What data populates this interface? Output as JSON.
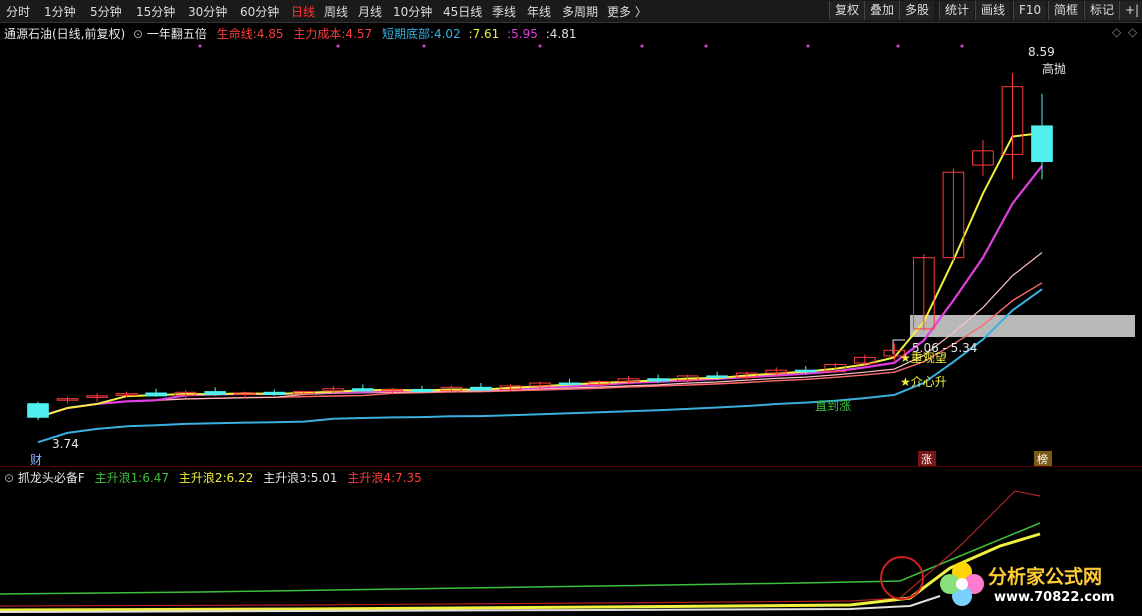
{
  "toolbar": {
    "periods": [
      "分时",
      "1分钟",
      "5分钟",
      "15分钟",
      "30分钟",
      "60分钟",
      "日线",
      "周线",
      "月线",
      "10分钟",
      "45日线",
      "季线",
      "年线",
      "多周期",
      "更多 〉"
    ],
    "active": "日线",
    "right": [
      "复权",
      "叠加",
      "多股",
      "统计",
      "画线",
      "F10",
      "简框",
      "标记",
      "+|"
    ]
  },
  "main_info": {
    "stock": "通源石油(日线,前复权)",
    "indicator": "一年翻五倍",
    "items": [
      {
        "label": "生命线:",
        "value": "4.85",
        "color": "#ff3b3b"
      },
      {
        "label": "主力成本:",
        "value": "4.57",
        "color": "#ff3b3b"
      },
      {
        "label": "短期底部:",
        "value": "4.02",
        "color": "#3ab0e0"
      },
      {
        "label": ":",
        "value": "7.61",
        "color": "#f0f040"
      },
      {
        "label": ":",
        "value": "5.95",
        "color": "#e040e0"
      },
      {
        "label": ":",
        "value": "4.81",
        "color": "#e0e0e0"
      }
    ]
  },
  "sub_info": {
    "indicator": "抓龙头必备F",
    "items": [
      {
        "label": "主升浪1:",
        "value": "6.47",
        "color": "#3cc03c"
      },
      {
        "label": "主升浪2:",
        "value": "6.22",
        "color": "#f0f040"
      },
      {
        "label": "主升浪3:",
        "value": "5.01",
        "color": "#e0e0e0"
      },
      {
        "label": "主升浪4:",
        "value": "7.35",
        "color": "#ff3b3b"
      }
    ]
  },
  "annotations": {
    "high": "8.59",
    "high_tag": "高抛",
    "low": "3.74",
    "zone": "5.06 - 5.34",
    "star1": "★重观望",
    "star2": "★介心升",
    "mid_text": "直到涨",
    "cai": "财",
    "zhang": "涨",
    "bang": "榜"
  },
  "watermark": {
    "text": "分析家公式网",
    "url": "www.70822.com"
  },
  "colors": {
    "up": "#ff3b3b",
    "down": "#50f0f0",
    "bg": "#000000"
  },
  "chart_data": {
    "type": "candlestick",
    "ylim": [
      3.3,
      9.0
    ],
    "note_levels": {
      "high": 8.59,
      "low": 3.74
    },
    "candles": [
      {
        "o": 3.95,
        "h": 3.98,
        "l": 3.72,
        "c": 3.76
      },
      {
        "o": 4.0,
        "h": 4.05,
        "l": 3.95,
        "c": 4.02
      },
      {
        "o": 4.04,
        "h": 4.1,
        "l": 3.98,
        "c": 4.06
      },
      {
        "o": 4.08,
        "h": 4.12,
        "l": 4.04,
        "c": 4.09
      },
      {
        "o": 4.1,
        "h": 4.16,
        "l": 4.05,
        "c": 4.06
      },
      {
        "o": 4.07,
        "h": 4.14,
        "l": 4.03,
        "c": 4.11
      },
      {
        "o": 4.12,
        "h": 4.18,
        "l": 4.06,
        "c": 4.08
      },
      {
        "o": 4.08,
        "h": 4.12,
        "l": 4.02,
        "c": 4.1
      },
      {
        "o": 4.11,
        "h": 4.15,
        "l": 4.06,
        "c": 4.08
      },
      {
        "o": 4.09,
        "h": 4.13,
        "l": 4.05,
        "c": 4.12
      },
      {
        "o": 4.13,
        "h": 4.2,
        "l": 4.1,
        "c": 4.16
      },
      {
        "o": 4.16,
        "h": 4.22,
        "l": 4.11,
        "c": 4.13
      },
      {
        "o": 4.13,
        "h": 4.17,
        "l": 4.08,
        "c": 4.15
      },
      {
        "o": 4.15,
        "h": 4.2,
        "l": 4.1,
        "c": 4.12
      },
      {
        "o": 4.13,
        "h": 4.2,
        "l": 4.1,
        "c": 4.18
      },
      {
        "o": 4.18,
        "h": 4.24,
        "l": 4.13,
        "c": 4.14
      },
      {
        "o": 4.15,
        "h": 4.22,
        "l": 4.12,
        "c": 4.2
      },
      {
        "o": 4.2,
        "h": 4.26,
        "l": 4.16,
        "c": 4.24
      },
      {
        "o": 4.24,
        "h": 4.3,
        "l": 4.2,
        "c": 4.22
      },
      {
        "o": 4.22,
        "h": 4.28,
        "l": 4.18,
        "c": 4.26
      },
      {
        "o": 4.26,
        "h": 4.34,
        "l": 4.22,
        "c": 4.3
      },
      {
        "o": 4.3,
        "h": 4.36,
        "l": 4.24,
        "c": 4.27
      },
      {
        "o": 4.28,
        "h": 4.36,
        "l": 4.25,
        "c": 4.34
      },
      {
        "o": 4.34,
        "h": 4.4,
        "l": 4.28,
        "c": 4.32
      },
      {
        "o": 4.32,
        "h": 4.4,
        "l": 4.28,
        "c": 4.38
      },
      {
        "o": 4.38,
        "h": 4.46,
        "l": 4.34,
        "c": 4.42
      },
      {
        "o": 4.42,
        "h": 4.48,
        "l": 4.36,
        "c": 4.4
      },
      {
        "o": 4.4,
        "h": 4.52,
        "l": 4.38,
        "c": 4.5
      },
      {
        "o": 4.52,
        "h": 4.64,
        "l": 4.48,
        "c": 4.6
      },
      {
        "o": 4.62,
        "h": 4.8,
        "l": 4.55,
        "c": 4.7
      },
      {
        "o": 5.0,
        "h": 6.05,
        "l": 4.98,
        "c": 6.0
      },
      {
        "o": 6.0,
        "h": 7.25,
        "l": 5.95,
        "c": 7.2
      },
      {
        "o": 7.3,
        "h": 7.65,
        "l": 7.15,
        "c": 7.5
      },
      {
        "o": 7.45,
        "h": 8.59,
        "l": 7.1,
        "c": 8.4
      },
      {
        "o": 7.85,
        "h": 8.3,
        "l": 7.1,
        "c": 7.35
      }
    ]
  }
}
